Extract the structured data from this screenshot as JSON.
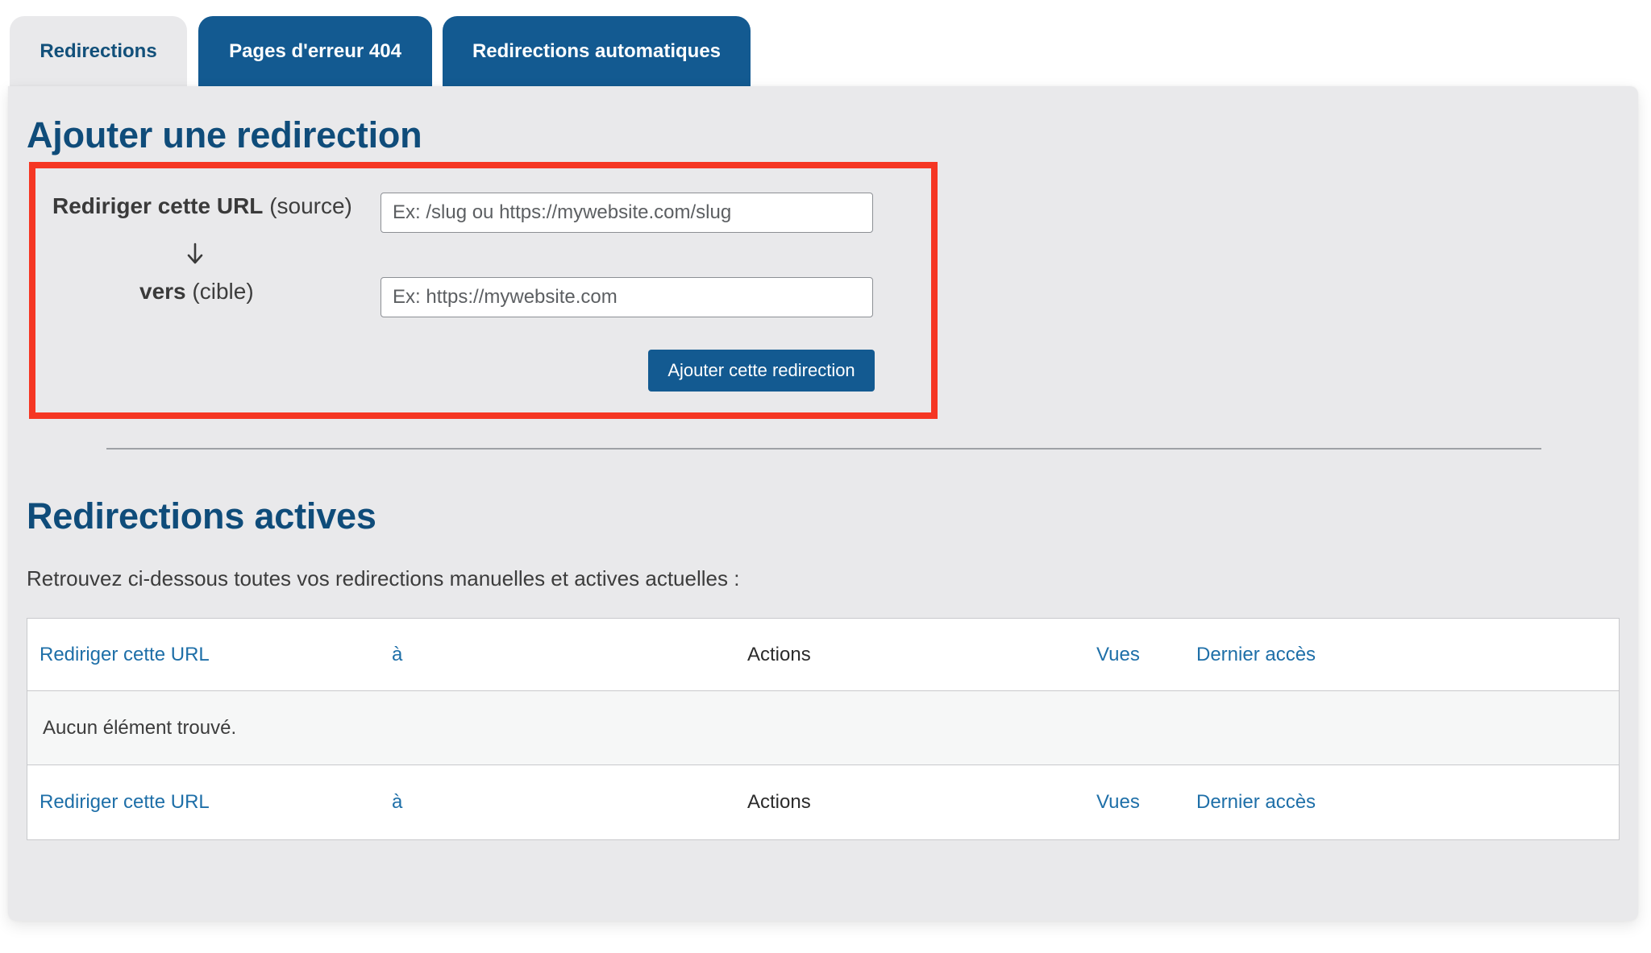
{
  "tabs": [
    {
      "label": "Redirections",
      "active": true
    },
    {
      "label": "Pages d'erreur 404",
      "active": false
    },
    {
      "label": "Redirections automatiques",
      "active": false
    }
  ],
  "add_section": {
    "title": "Ajouter une redirection",
    "source_label_bold": "Rediriger cette URL",
    "source_label_suffix": "(source)",
    "target_label_bold": "vers",
    "target_label_suffix": "(cible)",
    "source_placeholder": "Ex: /slug ou https://mywebsite.com/slug",
    "target_placeholder": "Ex: https://mywebsite.com",
    "source_value": "",
    "target_value": "",
    "submit_label": "Ajouter cette redirection",
    "arrow_icon": "arrow-down-icon"
  },
  "active_section": {
    "title": "Redirections actives",
    "description": "Retrouvez ci-dessous toutes vos redirections manuelles et actives actuelles :",
    "columns": {
      "source": "Rediriger cette URL",
      "target": "à",
      "actions": "Actions",
      "views": "Vues",
      "last_access": "Dernier accès"
    },
    "empty_message": "Aucun élément trouvé."
  },
  "colors": {
    "primary": "#135a91",
    "heading": "#0f4c7a",
    "highlight_border": "#f53623",
    "link": "#1e6fa8",
    "panel_bg": "#e9e9eb"
  }
}
